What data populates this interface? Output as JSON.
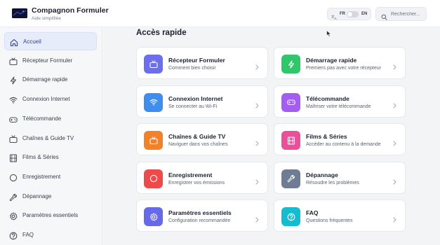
{
  "header": {
    "title": "Compagnon Formuler",
    "subtitle": "Aide simplifiée",
    "lang_fr": "FR",
    "lang_en": "EN",
    "search_placeholder": "Rechercher..."
  },
  "sidebar": {
    "items": [
      {
        "label": "Accueil",
        "icon": "home-icon",
        "active": true
      },
      {
        "label": "Récepteur Formuler",
        "icon": "tv-icon"
      },
      {
        "label": "Démarrage rapide",
        "icon": "lightning-icon"
      },
      {
        "label": "Connexion Internet",
        "icon": "wifi-icon"
      },
      {
        "label": "Télécommande",
        "icon": "gamepad-icon"
      },
      {
        "label": "Chaînes & Guide TV",
        "icon": "tv-icon"
      },
      {
        "label": "Films & Séries",
        "icon": "film-icon"
      },
      {
        "label": "Enregistrement",
        "icon": "record-icon"
      },
      {
        "label": "Dépannage",
        "icon": "wrench-icon"
      },
      {
        "label": "Paramètres essentiels",
        "icon": "gear-icon"
      },
      {
        "label": "FAQ",
        "icon": "help-icon"
      }
    ]
  },
  "main": {
    "section_title": "Accès rapide",
    "cards": [
      {
        "title": "Récepteur Formuler",
        "subtitle": "Comment bien choisir",
        "icon": "tv-icon",
        "color": "#6c6ef0"
      },
      {
        "title": "Démarrage rapide",
        "subtitle": "Premiers pas avec votre récepteur",
        "icon": "lightning-icon",
        "color": "#2fc76a"
      },
      {
        "title": "Connexion Internet",
        "subtitle": "Se connecter au Wi-Fi",
        "icon": "wifi-icon",
        "color": "#3e8ef0"
      },
      {
        "title": "Télécommande",
        "subtitle": "Maîtriser votre télécommande",
        "icon": "gamepad-icon",
        "color": "#a35df0"
      },
      {
        "title": "Chaînes & Guide TV",
        "subtitle": "Naviguer dans vos chaînes",
        "icon": "tv-icon",
        "color": "#f2812a"
      },
      {
        "title": "Films & Séries",
        "subtitle": "Accéder au contenu à la demande",
        "icon": "film-icon",
        "color": "#ea4f9a"
      },
      {
        "title": "Enregistrement",
        "subtitle": "Enregistrer vos émissions",
        "icon": "record-icon",
        "color": "#ef4a4a"
      },
      {
        "title": "Dépannage",
        "subtitle": "Résoudre les problèmes",
        "icon": "wrench-icon",
        "color": "#6e7c94"
      },
      {
        "title": "Paramètres essentiels",
        "subtitle": "Configuration recommandée",
        "icon": "gear-icon",
        "color": "#6669ea"
      },
      {
        "title": "FAQ",
        "subtitle": "Questions fréquentes",
        "icon": "help-icon",
        "color": "#14bcd2"
      }
    ]
  },
  "colors": {
    "accent": "#2c3fa3",
    "active_bg": "#e7ecfb"
  }
}
